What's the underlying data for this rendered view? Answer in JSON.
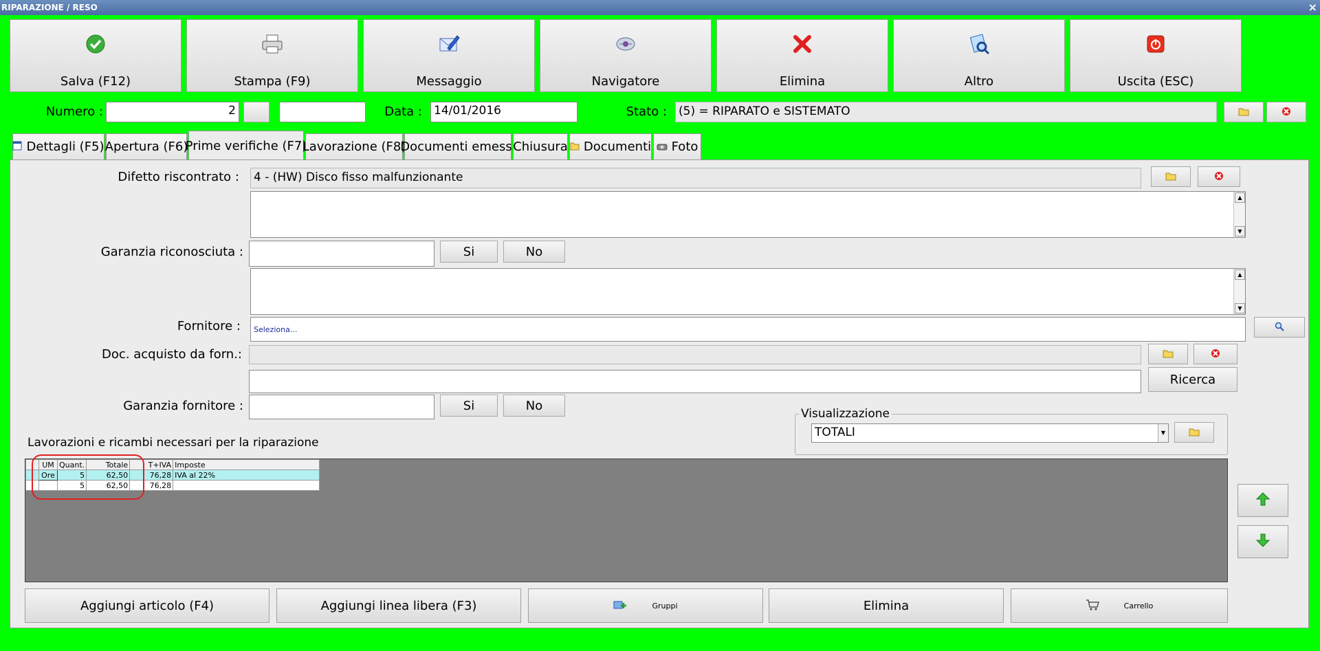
{
  "window": {
    "title": "RIPARAZIONE / RESO",
    "close": "×"
  },
  "toolbar": [
    {
      "label": "Salva (F12)",
      "icon": "check-icon"
    },
    {
      "label": "Stampa (F9)",
      "icon": "printer-icon"
    },
    {
      "label": "Messaggio",
      "icon": "message-icon"
    },
    {
      "label": "Navigatore",
      "icon": "navigator-icon"
    },
    {
      "label": "Elimina",
      "icon": "delete-icon"
    },
    {
      "label": "Altro",
      "icon": "more-icon"
    },
    {
      "label": "Uscita (ESC)",
      "icon": "exit-icon"
    }
  ],
  "header": {
    "numero_label": "Numero :",
    "numero_value": "2",
    "data_label": "Data :",
    "data_value": "14/01/2016",
    "stato_label": "Stato :",
    "stato_value": "(5) = RIPARATO e SISTEMATO"
  },
  "tabs": [
    {
      "label": "Dettagli (F5)",
      "icon": "details-icon"
    },
    {
      "label": "Apertura (F6)"
    },
    {
      "label": "Prime verifiche (F7)",
      "active": true
    },
    {
      "label": "Lavorazione (F8)"
    },
    {
      "label": "Documenti emessi"
    },
    {
      "label": "Chiusura"
    },
    {
      "label": "Documenti",
      "icon": "folder-icon"
    },
    {
      "label": "Foto",
      "icon": "camera-icon"
    }
  ],
  "form": {
    "difetto_label": "Difetto riscontrato :",
    "difetto_value": "4 - (HW) Disco fisso malfunzionante",
    "garanzia_label": "Garanzia riconosciuta :",
    "si": "Si",
    "no": "No",
    "fornitore_label": "Fornitore :",
    "fornitore_placeholder": "Seleziona...",
    "doc_label": "Doc. acquisto da forn.:",
    "ricerca": "Ricerca",
    "garanzia_forn_label": "Garanzia fornitore :",
    "visualizzazione_label": "Visualizzazione",
    "visualizzazione_value": "TOTALI",
    "lavorazioni_label": "Lavorazioni e ricambi necessari per la riparazione"
  },
  "grid": {
    "headers": [
      "UM",
      "Quant.",
      "Totale",
      "T+IVA",
      "Imposte"
    ],
    "rows": [
      [
        "Ore",
        "5",
        "62,50",
        "76,28",
        "IVA al 22%"
      ],
      [
        "",
        "5",
        "62,50",
        "76,28",
        ""
      ]
    ]
  },
  "bottom_buttons": [
    {
      "label": "Aggiungi articolo (F4)"
    },
    {
      "label": "Aggiungi linea libera (F3)"
    },
    {
      "label": "Gruppi",
      "icon": "groups-add-icon"
    },
    {
      "label": "Elimina"
    },
    {
      "label": "Carrello",
      "icon": "cart-icon"
    }
  ],
  "colors": {
    "background": "#00ff00",
    "highlight": "#e02020",
    "selected_row": "#b3f0f0"
  }
}
